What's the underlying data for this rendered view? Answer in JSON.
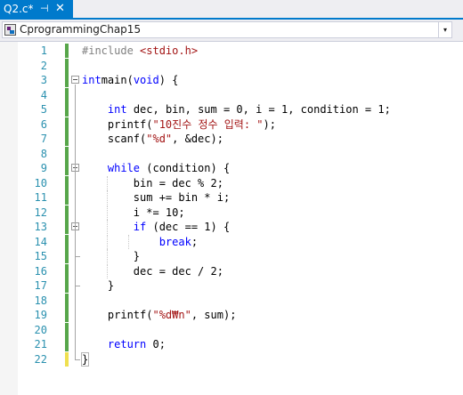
{
  "tab": {
    "filename": "Q2.c*",
    "pin_glyph": "⊣",
    "close_glyph": "✕"
  },
  "navigation": {
    "project": "CprogrammingChap15",
    "dropdown_glyph": "▾"
  },
  "editor": {
    "lines": [
      {
        "n": "1",
        "tokens": [
          [
            "pp",
            "#include "
          ],
          [
            "hdr",
            "<stdio.h>"
          ]
        ]
      },
      {
        "n": "2",
        "tokens": []
      },
      {
        "n": "3",
        "tokens": [
          [
            "kw",
            "int"
          ],
          [
            "",
            "main("
          ],
          [
            "kw",
            "void"
          ],
          [
            "",
            ") {"
          ]
        ]
      },
      {
        "n": "4",
        "tokens": []
      },
      {
        "n": "5",
        "tokens": [
          [
            "",
            "    "
          ],
          [
            "kw",
            "int"
          ],
          [
            "",
            " dec, bin, sum = 0, i = 1, condition = 1;"
          ]
        ]
      },
      {
        "n": "6",
        "tokens": [
          [
            "",
            "    printf("
          ],
          [
            "str",
            "\"10진수 정수 입력: \""
          ],
          [
            "",
            ");"
          ]
        ]
      },
      {
        "n": "7",
        "tokens": [
          [
            "",
            "    scanf("
          ],
          [
            "str",
            "\"%d\""
          ],
          [
            "",
            ", &dec);"
          ]
        ]
      },
      {
        "n": "8",
        "tokens": []
      },
      {
        "n": "9",
        "tokens": [
          [
            "",
            "    "
          ],
          [
            "kw",
            "while"
          ],
          [
            "",
            " (condition) {"
          ]
        ]
      },
      {
        "n": "10",
        "tokens": [
          [
            "",
            "        bin = dec % 2;"
          ]
        ]
      },
      {
        "n": "11",
        "tokens": [
          [
            "",
            "        sum += bin * i;"
          ]
        ]
      },
      {
        "n": "12",
        "tokens": [
          [
            "",
            "        i *= 10;"
          ]
        ]
      },
      {
        "n": "13",
        "tokens": [
          [
            "",
            "        "
          ],
          [
            "kw",
            "if"
          ],
          [
            "",
            " (dec == 1) {"
          ]
        ]
      },
      {
        "n": "14",
        "tokens": [
          [
            "",
            "            "
          ],
          [
            "kw",
            "break"
          ],
          [
            "",
            ";"
          ]
        ]
      },
      {
        "n": "15",
        "tokens": [
          [
            "",
            "        }"
          ]
        ]
      },
      {
        "n": "16",
        "tokens": [
          [
            "",
            "        dec = dec / 2;"
          ]
        ]
      },
      {
        "n": "17",
        "tokens": [
          [
            "",
            "    }"
          ]
        ]
      },
      {
        "n": "18",
        "tokens": []
      },
      {
        "n": "19",
        "tokens": [
          [
            "",
            "    printf("
          ],
          [
            "str",
            "\"%d₩n\""
          ],
          [
            "",
            ", sum);"
          ]
        ]
      },
      {
        "n": "20",
        "tokens": []
      },
      {
        "n": "21",
        "tokens": [
          [
            "",
            "    "
          ],
          [
            "kw",
            "return"
          ],
          [
            "",
            " 0;"
          ]
        ]
      },
      {
        "n": "22",
        "tokens": [
          [
            "",
            "}"
          ]
        ]
      }
    ],
    "unsaved_line": "22",
    "fold_lines": [
      "3",
      "9",
      "13"
    ]
  },
  "colors": {
    "accent": "#007acc",
    "keyword": "#0000ff",
    "string": "#a31515",
    "line_number": "#2b91af",
    "saved_change": "#57a64a",
    "unsaved_change": "#efe04f"
  }
}
